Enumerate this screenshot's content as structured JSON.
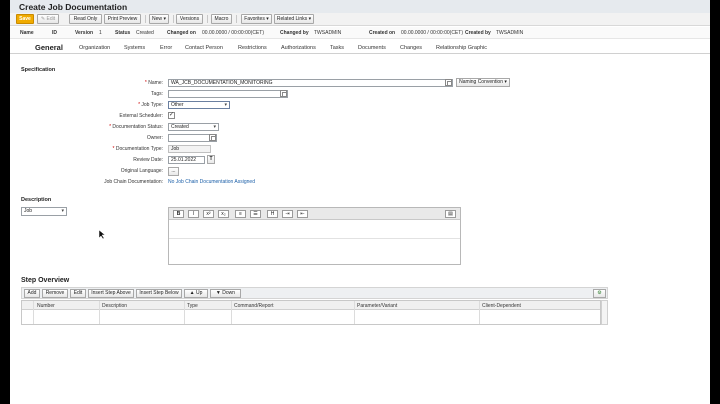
{
  "window": {
    "title": "Create Job Documentation"
  },
  "toolbar": {
    "save": "Save",
    "edit": "Edit",
    "read_only": "Read Only",
    "print_preview": "Print Preview",
    "new": "New",
    "versions": "Versions",
    "macro": "Macro",
    "favorites": "Favorites",
    "related_links": "Related Links"
  },
  "header": {
    "name_label": "Name",
    "id_label": "ID",
    "version_label": "Version",
    "version_value": "1",
    "status_label": "Status",
    "status_value": "Created",
    "changed_on_label": "Changed on",
    "changed_on_value": "00.00.0000 / 00:00:00(CET)",
    "changed_by_label": "Changed by",
    "changed_by_value": "TWSADMIN",
    "created_on_label": "Created on",
    "created_on_value": "00.00.0000 / 00:00:00(CET)",
    "created_by_label": "Created by",
    "created_by_value": "TWSADMIN"
  },
  "tabs": [
    {
      "label": "General"
    },
    {
      "label": "Organization"
    },
    {
      "label": "Systems"
    },
    {
      "label": "Error"
    },
    {
      "label": "Contact Person"
    },
    {
      "label": "Restrictions"
    },
    {
      "label": "Authorizations"
    },
    {
      "label": "Tasks"
    },
    {
      "label": "Documents"
    },
    {
      "label": "Changes"
    },
    {
      "label": "Relationship Graphic"
    }
  ],
  "specification": {
    "title": "Specification",
    "name_label": "Name:",
    "name_value": "WA_JCB_DOCUMENTATION_MONITORING",
    "naming_convention": "Naming Convention",
    "tags_label": "Tags:",
    "job_type_label": "Job Type:",
    "job_type_value": "Other",
    "external_scheduler_label": "External Scheduler:",
    "doc_status_label": "Documentation Status:",
    "doc_status_value": "Created",
    "owner_label": "Owner:",
    "doc_type_label": "Documentation Type:",
    "doc_type_value": "Job",
    "review_date_label": "Review Date:",
    "review_date_value": "25.01.2022",
    "original_language_label": "Original Language:",
    "original_language_value": "...",
    "job_chain_label": "Job Chain Documentation:",
    "job_chain_value": "No Job Chain Documentation Assigned"
  },
  "description": {
    "title": "Description",
    "type_value": "Job"
  },
  "step_overview": {
    "title": "Step Overview",
    "buttons": [
      "Add",
      "Remove",
      "Edit",
      "Insert Step Above",
      "Insert Step Below",
      "Up",
      "Down"
    ],
    "columns": [
      "Number",
      "Description",
      "Type",
      "Command/Report",
      "Parameter/Variant",
      "Client-Dependent"
    ]
  }
}
